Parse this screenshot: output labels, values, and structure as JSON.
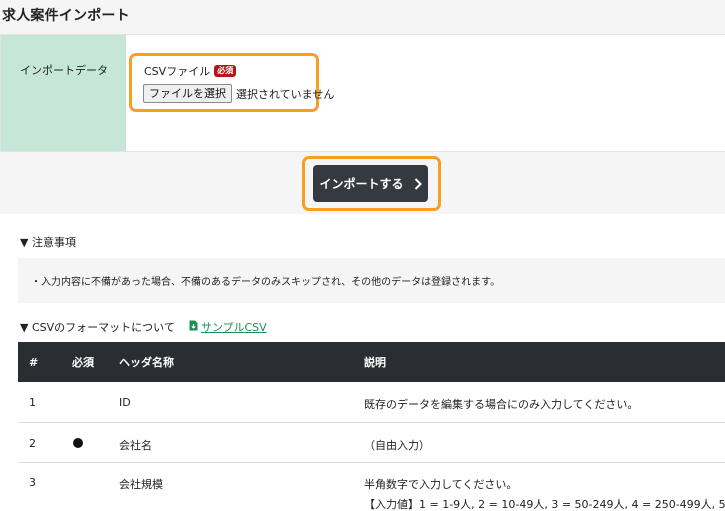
{
  "page": {
    "title": "求人案件インポート"
  },
  "form": {
    "label": "インポートデータ",
    "csv_label": "CSVファイル",
    "required_badge": "必須",
    "file_button": "ファイルを選択",
    "file_status": "選択されていません"
  },
  "import_button": {
    "label": "インポートする",
    "icon": "chevron-right-icon"
  },
  "notes": {
    "heading": "▼ 注意事項",
    "text": "・入力内容に不備があった場合、不備のあるデータのみスキップされ、その他のデータは登録されます。"
  },
  "format": {
    "heading": "▼ CSVのフォーマットについて",
    "sample_link": "サンプルCSV",
    "sample_icon": "file-download-icon"
  },
  "table": {
    "headers": {
      "num": "#",
      "required": "必須",
      "name": "ヘッダ名称",
      "desc": "説明"
    },
    "rows": [
      {
        "num": "1",
        "required": false,
        "name": "ID",
        "desc": "既存のデータを編集する場合にのみ入力してください。",
        "desc2": ""
      },
      {
        "num": "2",
        "required": true,
        "name": "会社名",
        "desc": "（自由入力）",
        "desc2": ""
      },
      {
        "num": "3",
        "required": false,
        "name": "会社規模",
        "desc": "半角数字で入力してください。",
        "desc2": "【入力値】1 = 1-9人, 2 = 10-49人, 3 = 50-249人, 4 = 250-499人, 5 ="
      }
    ]
  },
  "colors": {
    "label_bg": "#c6e7d8",
    "highlight": "#f5a023",
    "button_dark": "#343a40",
    "table_header": "#2a2e33",
    "badge_red": "#b01818",
    "link_green": "#1e8e55"
  }
}
